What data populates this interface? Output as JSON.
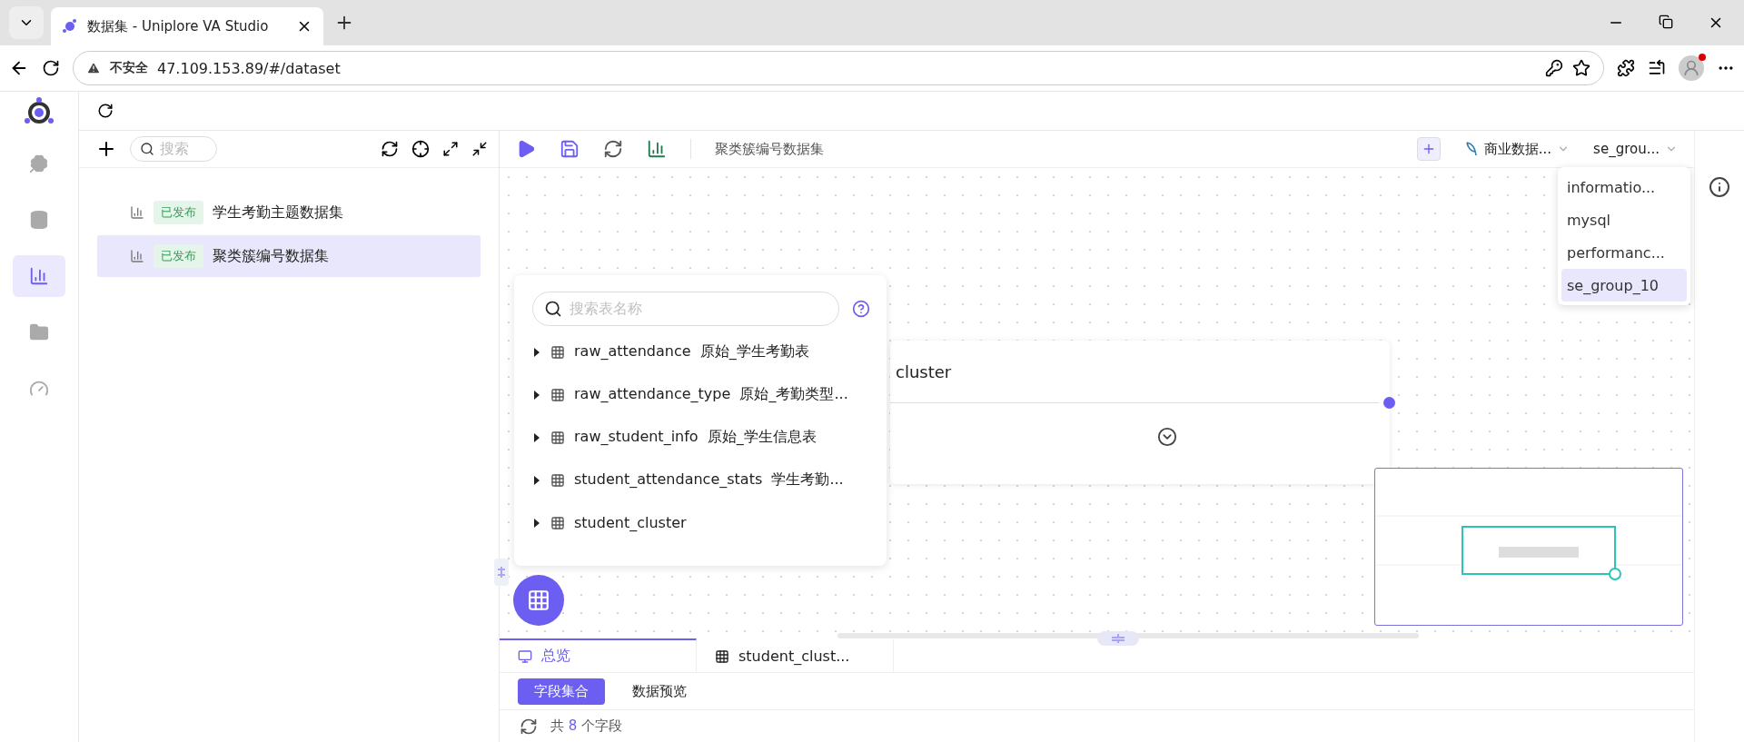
{
  "browser": {
    "tab_title": "数据集 - Uniplore VA Studio",
    "security_label": "不安全",
    "url": "47.109.153.89/#/dataset"
  },
  "rail_items": [
    {
      "kind": "clover",
      "selected": false
    },
    {
      "kind": "database",
      "selected": false
    },
    {
      "kind": "dataset",
      "selected": true
    },
    {
      "kind": "folder",
      "selected": false
    },
    {
      "kind": "gauge",
      "selected": false
    }
  ],
  "left_panel": {
    "search_placeholder": "搜索",
    "datasets": [
      {
        "status": "已发布",
        "name": "学生考勤主题数据集",
        "selected": false
      },
      {
        "status": "已发布",
        "name": "聚类簇编号数据集",
        "selected": true
      }
    ]
  },
  "toolbar": {
    "dataset_name": "聚类簇编号数据集",
    "datasource": "商业数据...",
    "schema": "se_grou..."
  },
  "schema_menu": [
    {
      "label": "informatio...",
      "selected": false
    },
    {
      "label": "mysql",
      "selected": false
    },
    {
      "label": "performanc...",
      "selected": false
    },
    {
      "label": "se_group_10",
      "selected": true
    }
  ],
  "table_picker": {
    "placeholder": "搜索表名称",
    "tables": [
      {
        "name": "raw_attendance",
        "comment": "原始_学生考勤表"
      },
      {
        "name": "raw_attendance_type",
        "comment": "原始_考勤类型..."
      },
      {
        "name": "raw_student_info",
        "comment": "原始_学生信息表"
      },
      {
        "name": "student_attendance_stats",
        "comment": "学生考勤..."
      },
      {
        "name": "student_cluster"
      }
    ]
  },
  "node": {
    "title": "cluster"
  },
  "bottom": {
    "tabs": [
      {
        "kind": "overview",
        "label": "总览",
        "selected": true
      },
      {
        "kind": "table",
        "label": "student_clust...",
        "selected": false
      }
    ],
    "subtabs": [
      {
        "label": "字段集合",
        "selected": true
      },
      {
        "label": "数据预览",
        "selected": false
      }
    ],
    "count_prefix": "共",
    "count": "8",
    "count_suffix": "个字段"
  }
}
